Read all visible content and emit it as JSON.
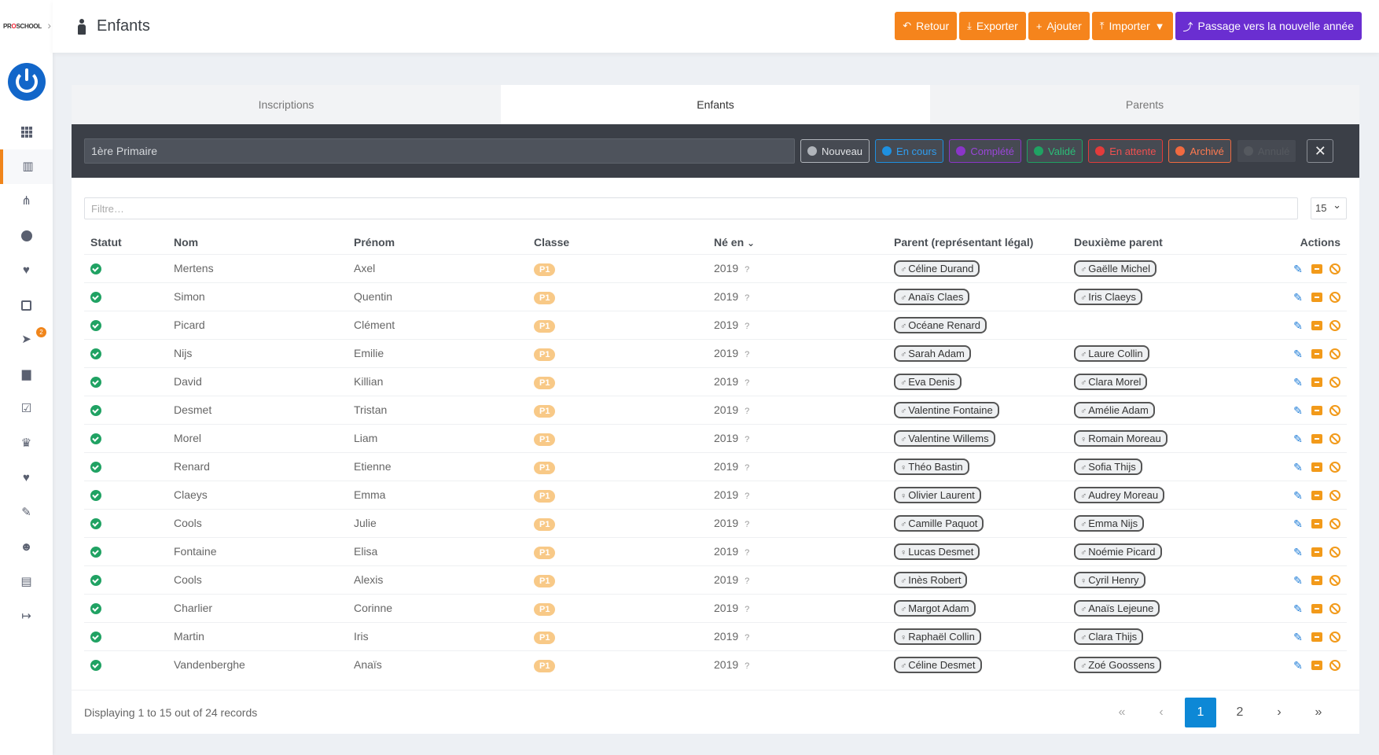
{
  "brand": {
    "logo_text_a": "PR",
    "logo_text_b": "O",
    "logo_text_c": "SCHOOL"
  },
  "header": {
    "title": "Enfants"
  },
  "toolbar": {
    "retour": "Retour",
    "exporter": "Exporter",
    "ajouter": "Ajouter",
    "importer": "Importer",
    "passage": "Passage vers la nouvelle année"
  },
  "sidebar": {
    "badge_count": "2"
  },
  "tabs": [
    {
      "label": "Inscriptions"
    },
    {
      "label": "Enfants"
    },
    {
      "label": "Parents"
    }
  ],
  "filters": {
    "class_selected": "1ère Primaire",
    "statuses": [
      {
        "label": "Nouveau",
        "color": "#b0b4ba",
        "text": "#e0e2e5"
      },
      {
        "label": "En cours",
        "color": "#1e90e0",
        "text": "#2f9ef0"
      },
      {
        "label": "Complété",
        "color": "#8a35c8",
        "text": "#9a46d8"
      },
      {
        "label": "Validé",
        "color": "#20a263",
        "text": "#2bbf78"
      },
      {
        "label": "En attente",
        "color": "#e23b3b",
        "text": "#f05050"
      },
      {
        "label": "Archivé",
        "color": "#f06a40",
        "text": "#ff7a50"
      },
      {
        "label": "Annulé",
        "color": "#3b3f47",
        "text": "#55595f"
      }
    ],
    "close": "✕"
  },
  "search": {
    "placeholder": "Filtre…"
  },
  "per_page": "15",
  "columns": {
    "statut": "Statut",
    "nom": "Nom",
    "prenom": "Prénom",
    "classe": "Classe",
    "ne_en": "Né en",
    "parent1": "Parent (représentant légal)",
    "parent2": "Deuxième parent",
    "actions": "Actions"
  },
  "rows": [
    {
      "nom": "Mertens",
      "prenom": "Axel",
      "classe": "P1",
      "annee": "2019",
      "p1": "Céline Durand",
      "p1s": "♂",
      "p2": "Gaëlle Michel",
      "p2s": "♂"
    },
    {
      "nom": "Simon",
      "prenom": "Quentin",
      "classe": "P1",
      "annee": "2019",
      "p1": "Anaïs Claes",
      "p1s": "♂",
      "p2": "Iris Claeys",
      "p2s": "♂"
    },
    {
      "nom": "Picard",
      "prenom": "Clément",
      "classe": "P1",
      "annee": "2019",
      "p1": "Océane Renard",
      "p1s": "♂",
      "p2": "",
      "p2s": ""
    },
    {
      "nom": "Nijs",
      "prenom": "Emilie",
      "classe": "P1",
      "annee": "2019",
      "p1": "Sarah Adam",
      "p1s": "♂",
      "p2": "Laure Collin",
      "p2s": "♂"
    },
    {
      "nom": "David",
      "prenom": "Killian",
      "classe": "P1",
      "annee": "2019",
      "p1": "Eva Denis",
      "p1s": "♂",
      "p2": "Clara Morel",
      "p2s": "♂"
    },
    {
      "nom": "Desmet",
      "prenom": "Tristan",
      "classe": "P1",
      "annee": "2019",
      "p1": "Valentine Fontaine",
      "p1s": "♂",
      "p2": "Amélie Adam",
      "p2s": "♂"
    },
    {
      "nom": "Morel",
      "prenom": "Liam",
      "classe": "P1",
      "annee": "2019",
      "p1": "Valentine Willems",
      "p1s": "♂",
      "p2": "Romain Moreau",
      "p2s": "♀"
    },
    {
      "nom": "Renard",
      "prenom": "Etienne",
      "classe": "P1",
      "annee": "2019",
      "p1": "Théo Bastin",
      "p1s": "♀",
      "p2": "Sofia Thijs",
      "p2s": "♂"
    },
    {
      "nom": "Claeys",
      "prenom": "Emma",
      "classe": "P1",
      "annee": "2019",
      "p1": "Olivier Laurent",
      "p1s": "♀",
      "p2": "Audrey Moreau",
      "p2s": "♂"
    },
    {
      "nom": "Cools",
      "prenom": "Julie",
      "classe": "P1",
      "annee": "2019",
      "p1": "Camille Paquot",
      "p1s": "♂",
      "p2": "Emma Nijs",
      "p2s": "♂"
    },
    {
      "nom": "Fontaine",
      "prenom": "Elisa",
      "classe": "P1",
      "annee": "2019",
      "p1": "Lucas Desmet",
      "p1s": "♀",
      "p2": "Noémie Picard",
      "p2s": "♂"
    },
    {
      "nom": "Cools",
      "prenom": "Alexis",
      "classe": "P1",
      "annee": "2019",
      "p1": "Inès Robert",
      "p1s": "♂",
      "p2": "Cyril Henry",
      "p2s": "♀"
    },
    {
      "nom": "Charlier",
      "prenom": "Corinne",
      "classe": "P1",
      "annee": "2019",
      "p1": "Margot Adam",
      "p1s": "♂",
      "p2": "Anaïs Lejeune",
      "p2s": "♂"
    },
    {
      "nom": "Martin",
      "prenom": "Iris",
      "classe": "P1",
      "annee": "2019",
      "p1": "Raphaël Collin",
      "p1s": "♀",
      "p2": "Clara Thijs",
      "p2s": "♂"
    },
    {
      "nom": "Vandenberghe",
      "prenom": "Anaïs",
      "classe": "P1",
      "annee": "2019",
      "p1": "Céline Desmet",
      "p1s": "♂",
      "p2": "Zoé Goossens",
      "p2s": "♂"
    }
  ],
  "unknown_mark": "?",
  "footer": {
    "records": "Displaying 1 to 15 out of 24 records",
    "pages": [
      "1",
      "2"
    ],
    "first": "«",
    "prev": "‹",
    "next": "›",
    "last": "»"
  }
}
